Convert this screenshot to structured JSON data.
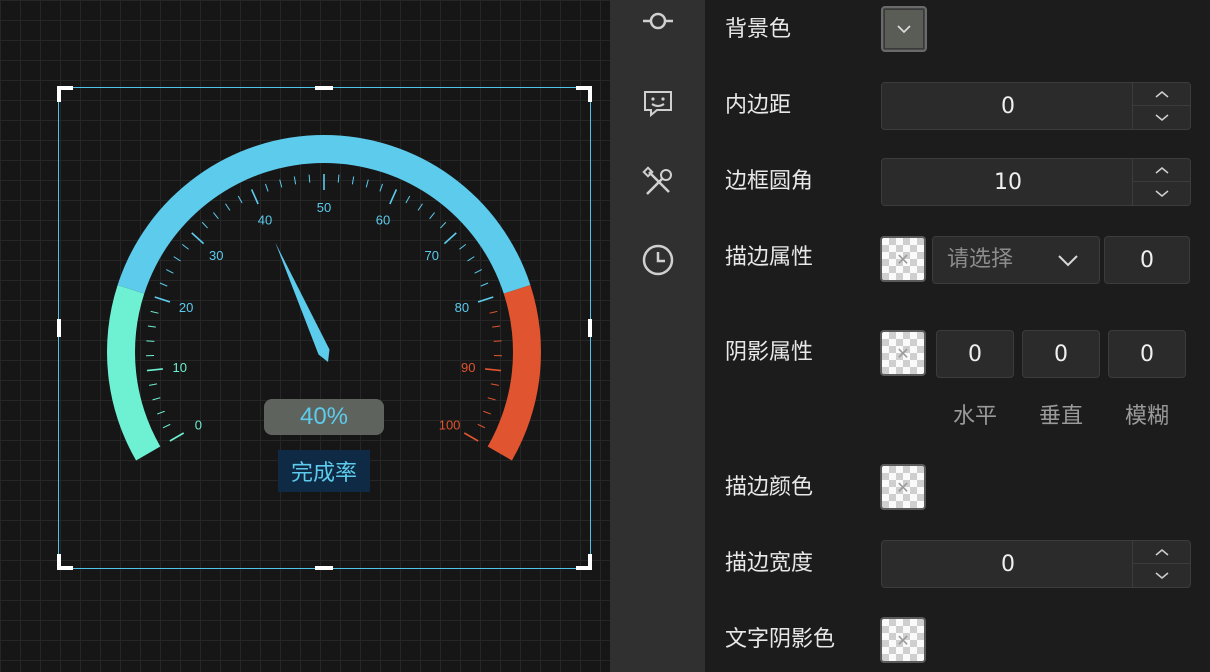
{
  "gauge": {
    "value_text": "40%",
    "caption": "完成率",
    "ticks": [
      "0",
      "10",
      "20",
      "30",
      "40",
      "50",
      "60",
      "70",
      "80",
      "90",
      "100"
    ],
    "value": 40,
    "min": 0,
    "max": 100,
    "colors": {
      "low": "#6ef0d2",
      "mid": "#5ccbec",
      "high": "#e0542f",
      "pointer": "#5ccbec",
      "value_bg": "#5f635e",
      "caption_bg": "#0f2a45",
      "tick_low": "#6ef0d2",
      "tick_mid": "#5ccbec",
      "tick_high": "#e0542f"
    }
  },
  "rail": {
    "icons": [
      "commit-node-icon",
      "chat-bot-icon",
      "tools-icon",
      "clock-icon"
    ]
  },
  "panel": {
    "bg_color_label": "背景色",
    "padding": {
      "label": "内边距",
      "value": "0"
    },
    "radius": {
      "label": "边框圆角",
      "value": "10"
    },
    "stroke_attr": {
      "label": "描边属性",
      "select_placeholder": "请选择",
      "value": "0"
    },
    "shadow_attr": {
      "label": "阴影属性",
      "horizontal": "0",
      "vertical": "0",
      "blur": "0",
      "horizontal_label": "水平",
      "vertical_label": "垂直",
      "blur_label": "模糊"
    },
    "stroke_color": {
      "label": "描边颜色"
    },
    "stroke_width": {
      "label": "描边宽度",
      "value": "0"
    },
    "text_shadow_color": {
      "label": "文字阴影色"
    }
  }
}
